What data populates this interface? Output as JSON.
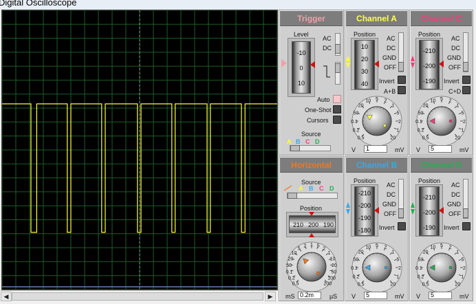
{
  "window": {
    "title": "Digital Oscilloscope"
  },
  "colors": {
    "screen_bg": "#000000",
    "grid": "#1c5c28",
    "grid_center": "#4a9a58",
    "trace": "#ffff40",
    "channel_a": "#ffff50",
    "channel_b": "#3aa8e8",
    "channel_c": "#ef3f7a",
    "channel_d": "#22b050",
    "trigger": "#f0a0a8",
    "horizontal": "#f07820"
  },
  "icons": {
    "scroll_left": "arrow-left-icon",
    "scroll_right": "arrow-right-icon",
    "pointer": "triangle-pointer-icon"
  },
  "screen": {
    "trace": {
      "high_level": 0.665,
      "low_level": 0.205,
      "pulses": [
        [
          0.105,
          0.126
        ],
        [
          0.237,
          0.25
        ],
        [
          0.362,
          0.375
        ],
        [
          0.492,
          0.505
        ],
        [
          0.617,
          0.629
        ],
        [
          0.745,
          0.757
        ],
        [
          0.87,
          0.883
        ]
      ]
    },
    "h_divisions": 20,
    "v_divisions": 20,
    "baseline_level": 0.01
  },
  "trigger": {
    "title": "Trigger",
    "level_label": "Level",
    "level_ticks": [
      "-10",
      "0",
      "10"
    ],
    "ac": "AC",
    "dc": "DC",
    "auto": "Auto",
    "one_shot": "One-Shot",
    "cursors": "Cursors",
    "source_label": "Source",
    "source_options": [
      "A",
      "B",
      "C",
      "D"
    ]
  },
  "channels": {
    "a": {
      "title": "Channel A",
      "position_label": "Position",
      "ticks": [
        "10",
        "20",
        "30",
        "40"
      ],
      "ac": "AC",
      "dc": "DC",
      "gnd": "GND",
      "off": "OFF",
      "invert": "Invert",
      "combine": "A+B",
      "dial": [
        "0.5",
        "0.2",
        "0.1",
        "50",
        "20",
        "10",
        "5",
        "2",
        "1",
        "5",
        "2",
        "1",
        "20"
      ],
      "unit_left": "V",
      "unit_right": "mV",
      "value": "1",
      "knob_angle": -60
    },
    "c": {
      "title": "Channel C",
      "position_label": "Position",
      "ticks": [
        "-210",
        "-200",
        "-190"
      ],
      "ac": "AC",
      "dc": "DC",
      "gnd": "GND",
      "off": "OFF",
      "invert": "Invert",
      "combine": "C+D",
      "dial": [
        "0.5",
        "0.2",
        "0.1",
        "50",
        "20",
        "10",
        "5",
        "2",
        "1",
        "5",
        "2",
        "1",
        "20"
      ],
      "unit_left": "V",
      "unit_right": "mV",
      "value": "5",
      "knob_angle": -90
    },
    "b": {
      "title": "Channel B",
      "position_label": "Position",
      "ticks": [
        "-210",
        "-200",
        "-190",
        "-180"
      ],
      "ac": "AC",
      "dc": "DC",
      "gnd": "GND",
      "off": "OFF",
      "invert": "Invert",
      "dial": [
        "0.5",
        "0.2",
        "0.1",
        "50",
        "20",
        "10",
        "5",
        "2",
        "1",
        "5",
        "2",
        "1",
        "20"
      ],
      "unit_left": "V",
      "unit_right": "mV",
      "value": "5",
      "knob_angle": -90
    },
    "d": {
      "title": "Channel D",
      "position_label": "Position",
      "ticks": [
        "-210",
        "-200",
        "-190"
      ],
      "ac": "AC",
      "dc": "DC",
      "gnd": "GND",
      "off": "OFF",
      "invert": "Invert",
      "dial": [
        "0.5",
        "0.2",
        "0.1",
        "50",
        "20",
        "10",
        "5",
        "2",
        "1",
        "5",
        "2",
        "1",
        "20"
      ],
      "unit_left": "V",
      "unit_right": "mV",
      "value": "5",
      "knob_angle": -90
    }
  },
  "horizontal": {
    "title": "Horizontal",
    "source_label": "Source",
    "source_options": [
      "A",
      "B",
      "C",
      "D"
    ],
    "position_label": "Position",
    "position_ticks": [
      "210",
      "200",
      "190"
    ],
    "dial": [
      "0.5",
      "0.2",
      "0.1",
      "50",
      "20",
      "10",
      "5",
      "2",
      "1",
      "5",
      "2",
      "1",
      "10",
      "20",
      "50",
      "100",
      "200"
    ],
    "unit_left": "mS",
    "unit_right": "µS",
    "value": "0.2m",
    "knob_angle": -45
  }
}
